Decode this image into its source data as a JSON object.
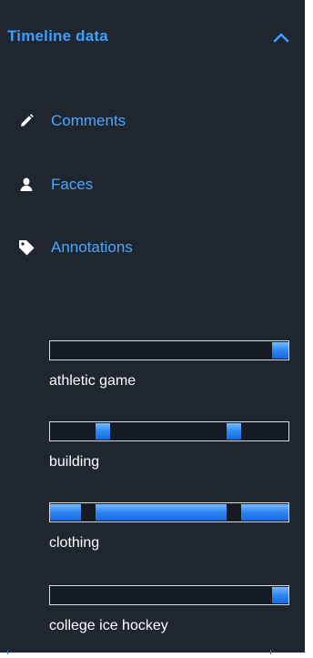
{
  "panel": {
    "title": "Timeline data",
    "collapse_icon": "chevron-up-icon"
  },
  "nav": {
    "items": [
      {
        "label": "Comments",
        "icon": "pencil-icon"
      },
      {
        "label": "Faces",
        "icon": "person-icon"
      },
      {
        "label": "Annotations",
        "icon": "tag-icon"
      }
    ]
  },
  "tracks": [
    {
      "label": "athletic game",
      "segments": [
        [
          0.93,
          1.0
        ]
      ]
    },
    {
      "label": "building",
      "segments": [
        [
          0.19,
          0.25
        ],
        [
          0.74,
          0.8
        ]
      ]
    },
    {
      "label": "clothing",
      "segments": [
        [
          0.0,
          0.13
        ],
        [
          0.19,
          0.74
        ],
        [
          0.8,
          1.0
        ]
      ]
    },
    {
      "label": "college ice hockey",
      "segments": [
        [
          0.93,
          1.0
        ]
      ]
    }
  ],
  "colors": {
    "panel_bg": "#1f2630",
    "accent": "#3aa0ff",
    "segment": "#2f86f5",
    "text": "#ffffff"
  }
}
